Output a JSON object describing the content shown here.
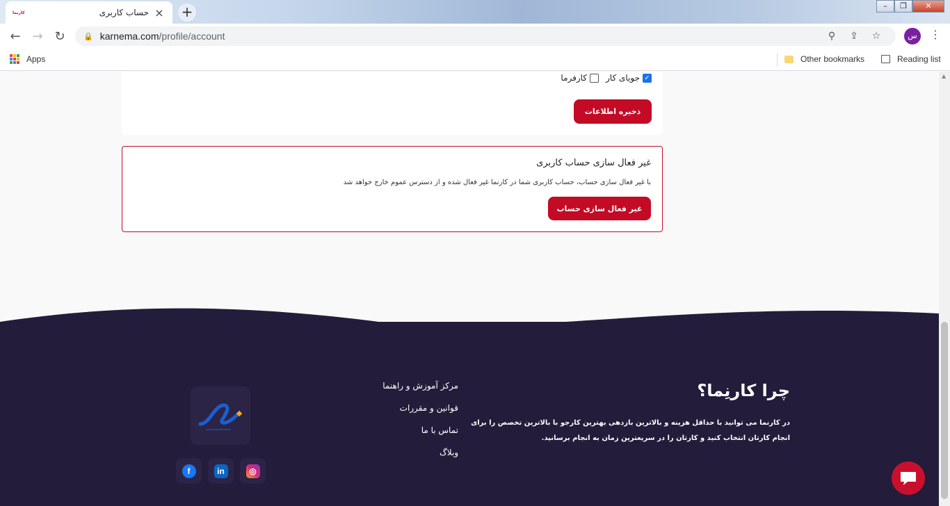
{
  "browser": {
    "tab_title": "حساب کاربری",
    "tab_favicon_text": "کارنما",
    "url_domain": "karnema.com",
    "url_path": "/profile/account",
    "profile_initial": "س",
    "bookmarks": {
      "apps_label": "Apps",
      "other_label": "Other bookmarks",
      "reading_label": "Reading list"
    }
  },
  "account_form": {
    "job_seeker_label": "جویای کار",
    "job_seeker_checked": true,
    "employer_label": "کارفرما",
    "employer_checked": false,
    "save_label": "ذخیره اطلاعات"
  },
  "deactivate": {
    "title": "غیر فعال سازی حساب کاربری",
    "description": "با غیر فعال سازی حساب، حساب کاربری شما در کارنما غیر فعال شده و از دسترس عموم خارج خواهد شد",
    "button_label": "غیر فعال سازی حساب"
  },
  "footer": {
    "why_title": "چرا کارنِما؟",
    "why_text": "در کارنما می توانید با حداقل هزینه و بالاترین بازدهی بهترین کارجو با بالاترین تخصص را برای انجام کارتان انتخاب کنید و کارتان را در سریعترین زمان به انجام برسانید.",
    "links": [
      "مرکز آموزش و راهنما",
      "قوانین و مقررات",
      "تماس با ما",
      "وبلاگ"
    ],
    "socials": [
      "instagram-icon",
      "linkedin-icon",
      "facebook-icon"
    ]
  },
  "colors": {
    "accent": "#c30b25",
    "footer_bg": "#231c3a"
  }
}
